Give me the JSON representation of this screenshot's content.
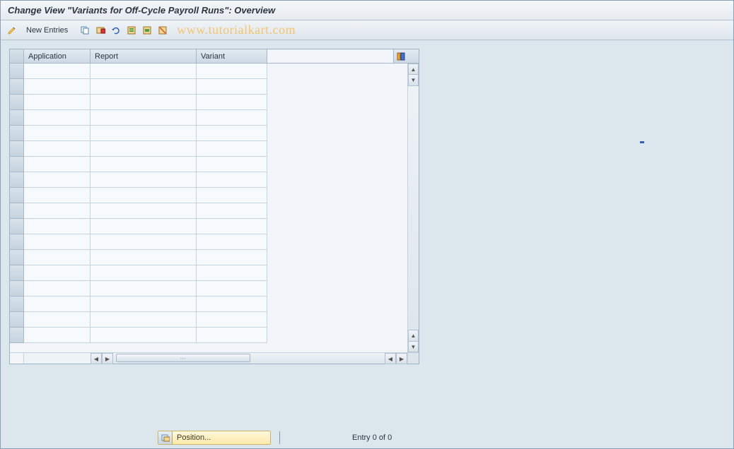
{
  "title": "Change View \"Variants for Off-Cycle Payroll Runs\": Overview",
  "toolbar": {
    "new_entries_label": "New Entries",
    "watermark": "www.tutorialkart.com"
  },
  "table": {
    "columns": {
      "application": "Application",
      "report": "Report",
      "variant": "Variant"
    },
    "rows": [
      {
        "application": "",
        "report": "",
        "variant": ""
      },
      {
        "application": "",
        "report": "",
        "variant": ""
      },
      {
        "application": "",
        "report": "",
        "variant": ""
      },
      {
        "application": "",
        "report": "",
        "variant": ""
      },
      {
        "application": "",
        "report": "",
        "variant": ""
      },
      {
        "application": "",
        "report": "",
        "variant": ""
      },
      {
        "application": "",
        "report": "",
        "variant": ""
      },
      {
        "application": "",
        "report": "",
        "variant": ""
      },
      {
        "application": "",
        "report": "",
        "variant": ""
      },
      {
        "application": "",
        "report": "",
        "variant": ""
      },
      {
        "application": "",
        "report": "",
        "variant": ""
      },
      {
        "application": "",
        "report": "",
        "variant": ""
      },
      {
        "application": "",
        "report": "",
        "variant": ""
      },
      {
        "application": "",
        "report": "",
        "variant": ""
      },
      {
        "application": "",
        "report": "",
        "variant": ""
      },
      {
        "application": "",
        "report": "",
        "variant": ""
      },
      {
        "application": "",
        "report": "",
        "variant": ""
      },
      {
        "application": "",
        "report": "",
        "variant": ""
      }
    ]
  },
  "footer": {
    "position_label": "Position...",
    "entry_text": "Entry 0 of 0"
  }
}
